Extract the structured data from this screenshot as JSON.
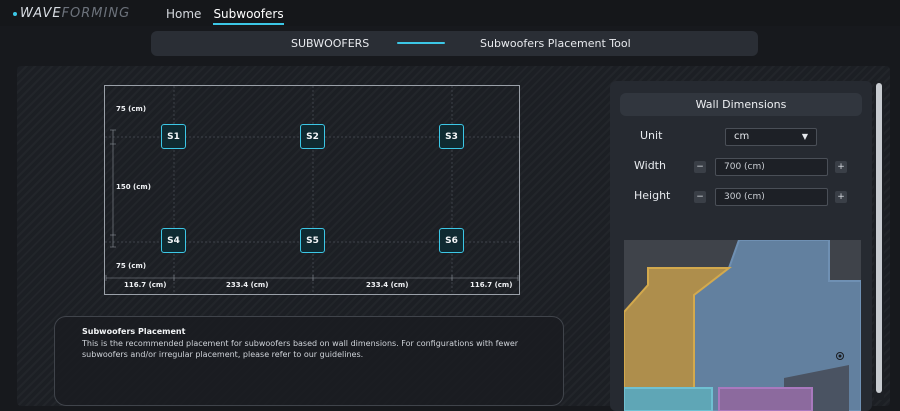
{
  "logo": {
    "part1": "WAVE",
    "part2": "FORMING"
  },
  "nav": {
    "home": "Home",
    "subwoofers": "Subwoofers"
  },
  "page_header": {
    "section": "SUBWOOFERS",
    "tool": "Subwoofers Placement Tool"
  },
  "diagram": {
    "labels": {
      "top": "75 (cm)",
      "middle": "150 (cm)",
      "bottom": "75 (cm)",
      "seg1": "116.7 (cm)",
      "seg2": "233.4 (cm)",
      "seg3": "233.4 (cm)",
      "seg4": "116.7 (cm)"
    },
    "subwoofers": [
      "S1",
      "S2",
      "S3",
      "S4",
      "S5",
      "S6"
    ]
  },
  "info": {
    "title": "Subwoofers Placement",
    "text": "This is the recommended placement for subwoofers based on wall dimensions. For configurations with fewer subwoofers and/or irregular placement, please refer to our guidelines."
  },
  "wall_dimensions": {
    "title": "Wall Dimensions",
    "unit_label": "Unit",
    "unit_value": "cm",
    "width_label": "Width",
    "width_value": "700 (cm)",
    "height_label": "Height",
    "height_value": "300 (cm)",
    "decrement": "−",
    "increment": "+"
  },
  "colors": {
    "accent": "#3cc7e6",
    "wall_blue": "#5f7fa0",
    "wall_yellow": "#c9a24a",
    "wall_teal": "#5fa9b8",
    "wall_purple": "#9a6aa8"
  }
}
